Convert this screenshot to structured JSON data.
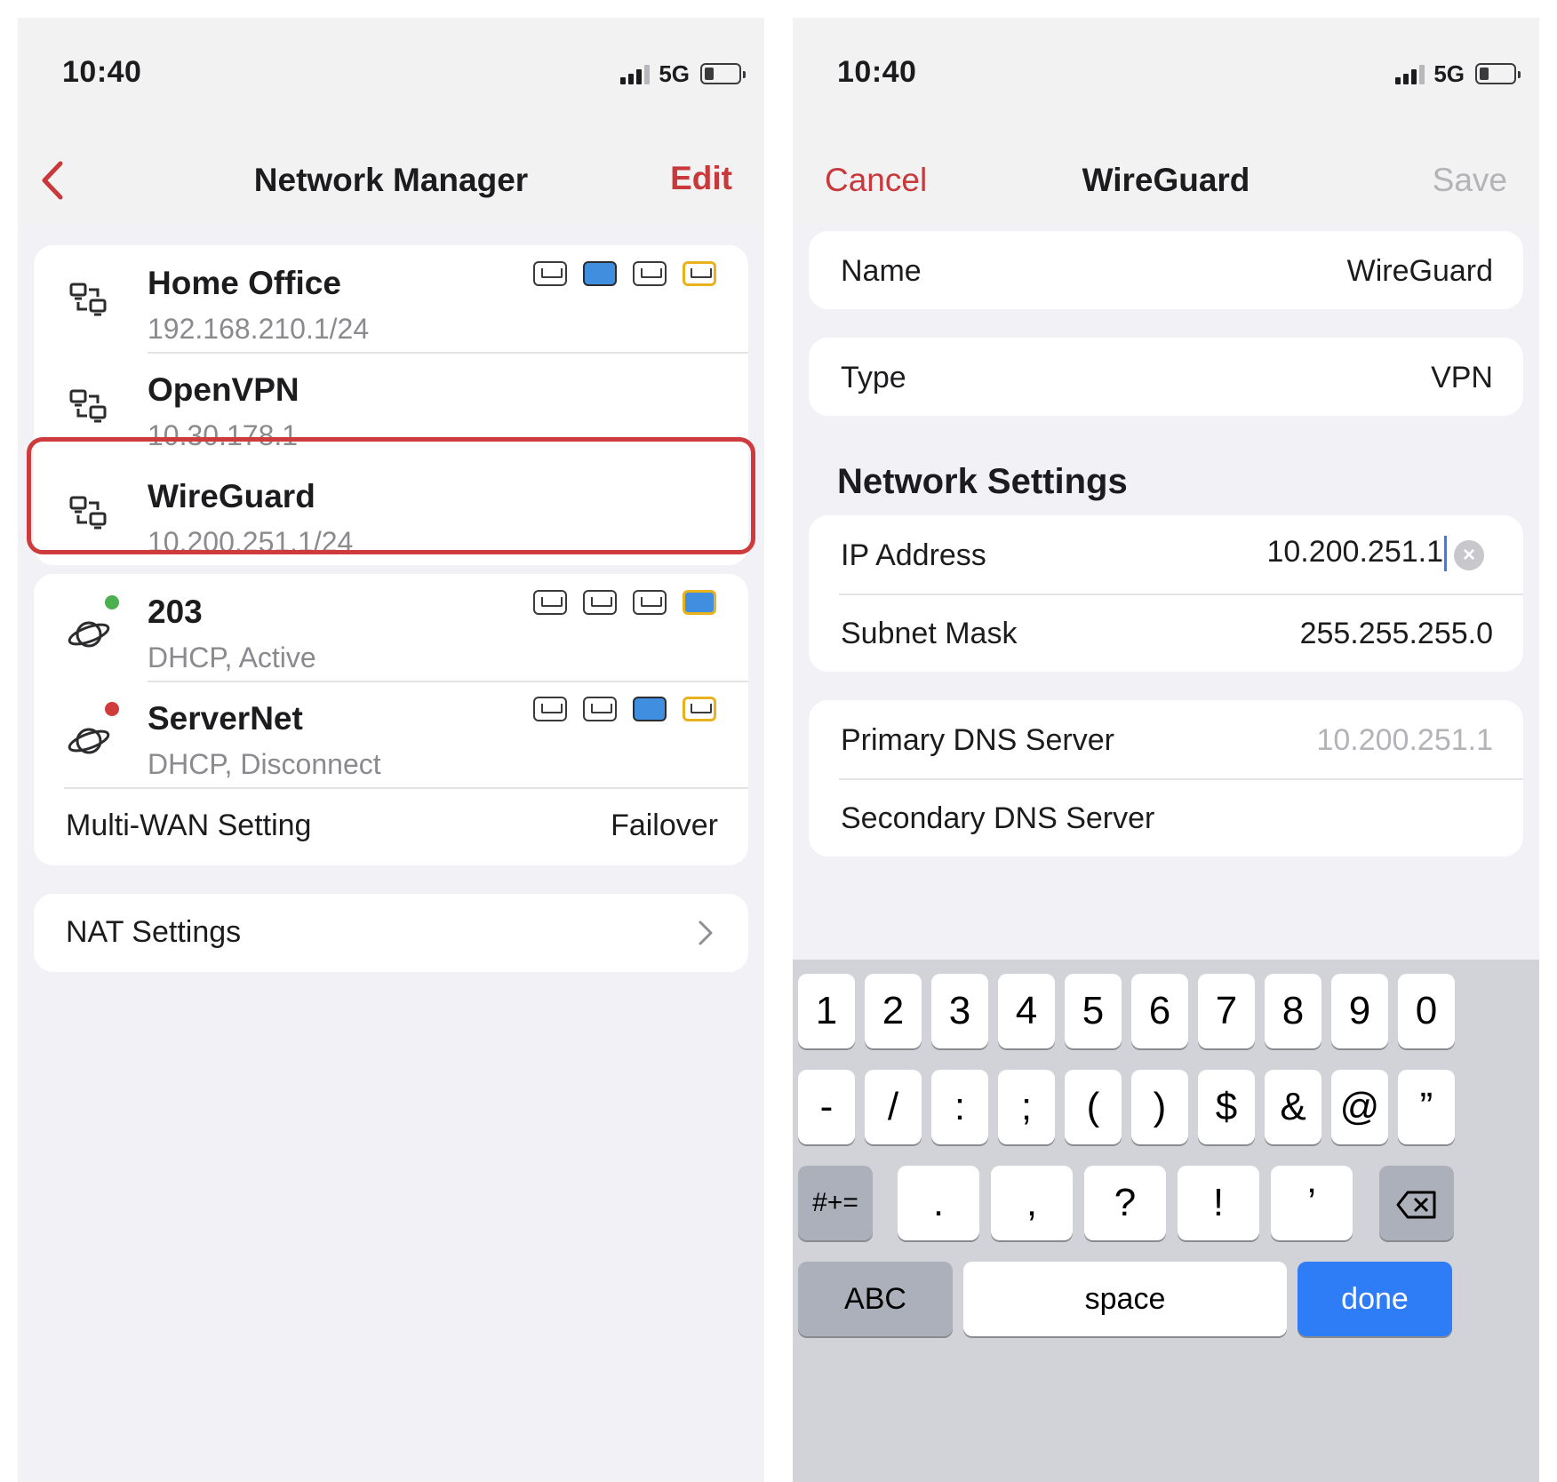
{
  "left_screen": {
    "status": {
      "time": "10:40",
      "network": "5G"
    },
    "nav": {
      "title": "Network Manager",
      "edit": "Edit"
    },
    "networks": [
      {
        "name": "Home Office",
        "sub": "192.168.210.1/24",
        "ports": [
          "idle",
          "active",
          "idle",
          "warn"
        ]
      },
      {
        "name": "OpenVPN",
        "sub": "10.30.178.1"
      },
      {
        "name": "WireGuard",
        "sub": "10.200.251.1/24",
        "highlighted": true
      }
    ],
    "wan": [
      {
        "name": "203",
        "sub": "DHCP, Active",
        "status_color": "#4caf50",
        "ports": [
          "idle",
          "idle",
          "idle",
          "active-warn"
        ]
      },
      {
        "name": "ServerNet",
        "sub": "DHCP, Disconnect",
        "status_color": "#d03c3c",
        "ports": [
          "idle",
          "idle",
          "active",
          "warn"
        ]
      }
    ],
    "multiwan": {
      "label": "Multi-WAN Setting",
      "value": "Failover"
    },
    "nat": {
      "label": "NAT Settings"
    }
  },
  "right_screen": {
    "status": {
      "time": "10:40",
      "network": "5G"
    },
    "nav": {
      "cancel": "Cancel",
      "title": "WireGuard",
      "save": "Save"
    },
    "name_row": {
      "label": "Name",
      "value": "WireGuard"
    },
    "type_row": {
      "label": "Type",
      "value": "VPN"
    },
    "section": "Network Settings",
    "ip_row": {
      "label": "IP Address",
      "value": "10.200.251.1"
    },
    "mask_row": {
      "label": "Subnet Mask",
      "value": "255.255.255.0"
    },
    "dns1_row": {
      "label": "Primary DNS Server",
      "placeholder": "10.200.251.1"
    },
    "dns2_row": {
      "label": "Secondary DNS Server"
    },
    "keyboard": {
      "row1": [
        "1",
        "2",
        "3",
        "4",
        "5",
        "6",
        "7",
        "8",
        "9",
        "0"
      ],
      "row2": [
        "-",
        "/",
        ":",
        ";",
        "(",
        ")",
        "$",
        "&",
        "@",
        "”"
      ],
      "row3_left": "#+=",
      "row3": [
        ".",
        ",",
        "?",
        "!",
        "’"
      ],
      "abc": "ABC",
      "space": "space",
      "done": "done"
    }
  },
  "colors": {
    "accent": "#c8393c",
    "port_active": "#3f8ee0",
    "port_warn": "#e8b21c",
    "keyboard_done": "#2f7df6"
  }
}
